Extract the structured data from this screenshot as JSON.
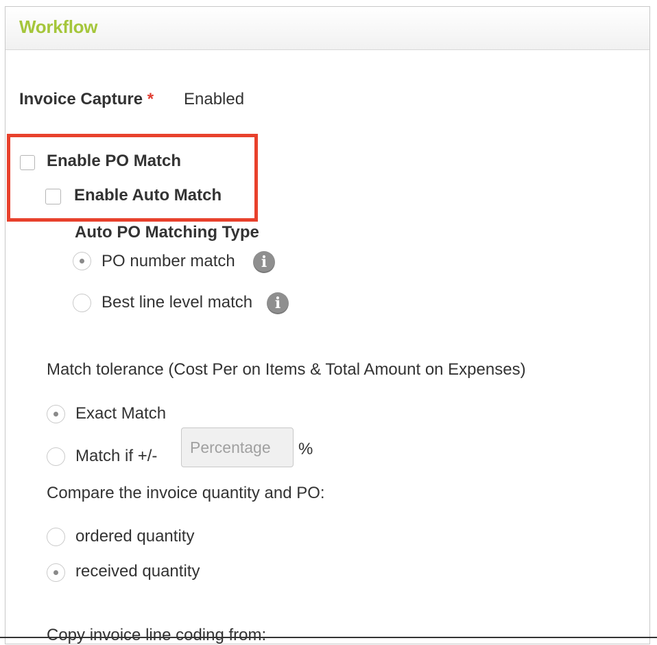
{
  "panel": {
    "title": "Workflow"
  },
  "invoice_capture": {
    "label": "Invoice Capture",
    "required_mark": "*",
    "value": "Enabled"
  },
  "po_match": {
    "enable_po_match_label": "Enable PO Match",
    "enable_po_match_checked": false,
    "enable_auto_match_label": "Enable Auto Match",
    "enable_auto_match_checked": false
  },
  "auto_matching_type": {
    "heading": "Auto PO Matching Type",
    "options": [
      {
        "label": "PO number match",
        "selected": true,
        "info_icon": "info-icon"
      },
      {
        "label": "Best line level match",
        "selected": false,
        "info_icon": "info-icon"
      }
    ]
  },
  "tolerance": {
    "heading": "Match tolerance (Cost Per on Items & Total Amount on Expenses)",
    "exact_label": "Exact Match",
    "exact_selected": true,
    "match_if_label": "Match if +/-",
    "match_if_selected": false,
    "percentage_placeholder": "Percentage",
    "percent_sign": "%"
  },
  "compare_quantity": {
    "heading": "Compare the invoice quantity and PO:",
    "options": [
      {
        "label": "ordered quantity",
        "selected": false
      },
      {
        "label": "received quantity",
        "selected": true
      }
    ]
  },
  "copy_coding": {
    "heading": "Copy invoice line coding from:"
  },
  "colors": {
    "title_green": "#a5c63b",
    "highlight_red": "#e8412c",
    "required_red": "#e03c31"
  }
}
